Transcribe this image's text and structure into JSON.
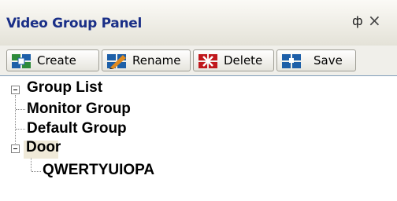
{
  "panel": {
    "title": "Video Group Panel",
    "pin_glyph": "ф",
    "close_glyph": "×"
  },
  "toolbar": {
    "buttons": [
      {
        "label": "Create",
        "icon": "create-group-icon"
      },
      {
        "label": "Rename",
        "icon": "rename-group-icon"
      },
      {
        "label": "Delete",
        "icon": "delete-group-icon"
      },
      {
        "label": "Save",
        "icon": "save-group-icon"
      }
    ]
  },
  "tree": {
    "root": "Group List",
    "items": [
      {
        "label": "Monitor Group"
      },
      {
        "label": "Default Group"
      },
      {
        "label": "Door",
        "expanded": true,
        "selected": true,
        "children": [
          {
            "label": "QWERTYUIOPA"
          }
        ]
      }
    ]
  },
  "colors": {
    "title_text": "#1a2f87",
    "icon_blue": "#1d5fa8",
    "icon_green": "#2e8b3a",
    "delete_red": "#c0181c",
    "selection": "#efe9d8"
  }
}
